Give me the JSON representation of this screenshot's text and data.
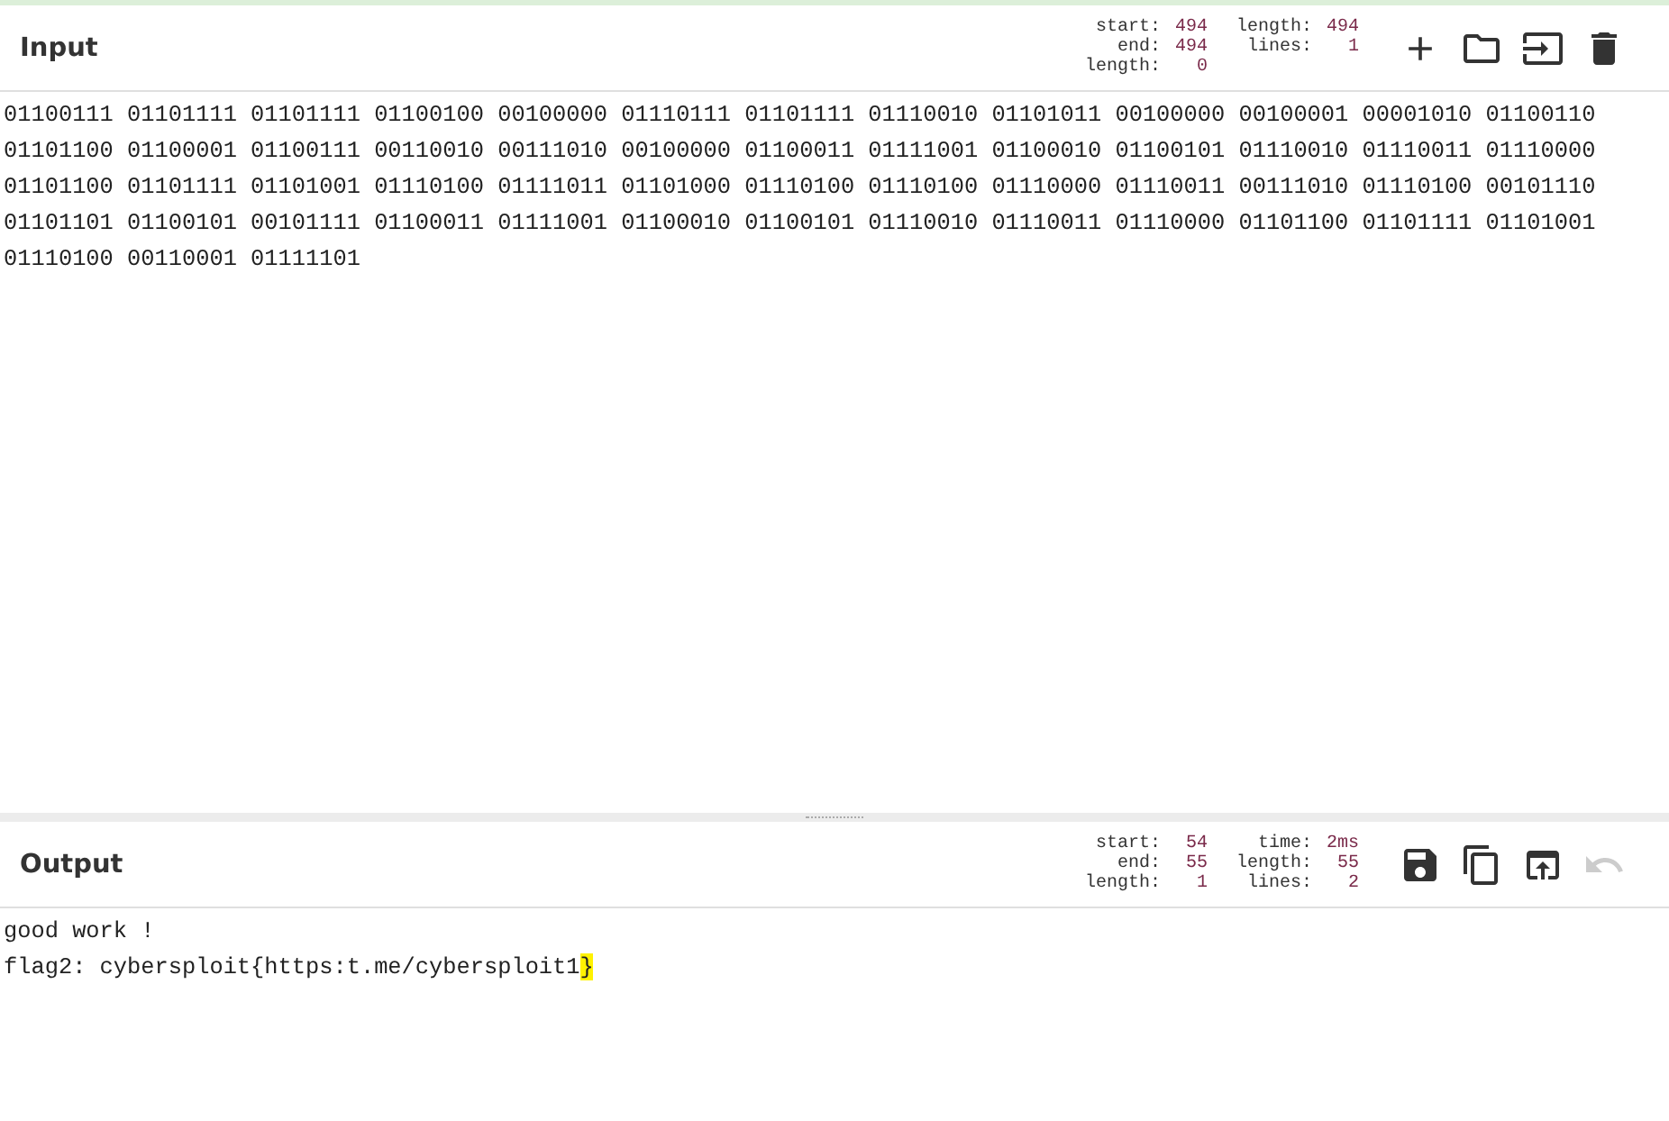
{
  "input": {
    "title": "Input",
    "stats": [
      [
        {
          "label": "start:",
          "value": "494"
        },
        {
          "label": "end:",
          "value": "494"
        },
        {
          "label": "length:",
          "value": "0"
        }
      ],
      [
        {
          "label": "length:",
          "value": "494"
        },
        {
          "label": "lines:",
          "value": "1"
        }
      ]
    ],
    "tools": [
      {
        "kind": "plus",
        "disabled": false
      },
      {
        "kind": "folder",
        "disabled": false
      },
      {
        "kind": "import",
        "disabled": false
      },
      {
        "kind": "trash",
        "disabled": false
      }
    ],
    "lines": [
      "01100111 01101111 01101111 01100100 00100000 01110111 01101111 01110010 01101011 00100000 00100001 00001010 01100110",
      "01101100 01100001 01100111 00110010 00111010 00100000 01100011 01111001 01100010 01100101 01110010 01110011 01110000",
      "01101100 01101111 01101001 01110100 01111011 01101000 01110100 01110100 01110000 01110011 00111010 01110100 00101110",
      "01101101 01100101 00101111 01100011 01111001 01100010 01100101 01110010 01110011 01110000 01101100 01101111 01101001",
      "01110100 00110001 01111101"
    ]
  },
  "output": {
    "title": "Output",
    "stats": [
      [
        {
          "label": "start:",
          "value": "54"
        },
        {
          "label": "end:",
          "value": "55"
        },
        {
          "label": "length:",
          "value": "1"
        }
      ],
      [
        {
          "label": "time:",
          "value": "2ms"
        },
        {
          "label": "length:",
          "value": "55"
        },
        {
          "label": "lines:",
          "value": "2"
        }
      ]
    ],
    "tools": [
      {
        "kind": "save",
        "disabled": false
      },
      {
        "kind": "copy",
        "disabled": false
      },
      {
        "kind": "to-input",
        "disabled": false
      },
      {
        "kind": "undo",
        "disabled": true
      }
    ],
    "lines": [
      {
        "text": "good work !"
      },
      {
        "text": "flag2: cybersploit{https:t.me/cybersploit1",
        "highlighted": "}"
      }
    ]
  }
}
